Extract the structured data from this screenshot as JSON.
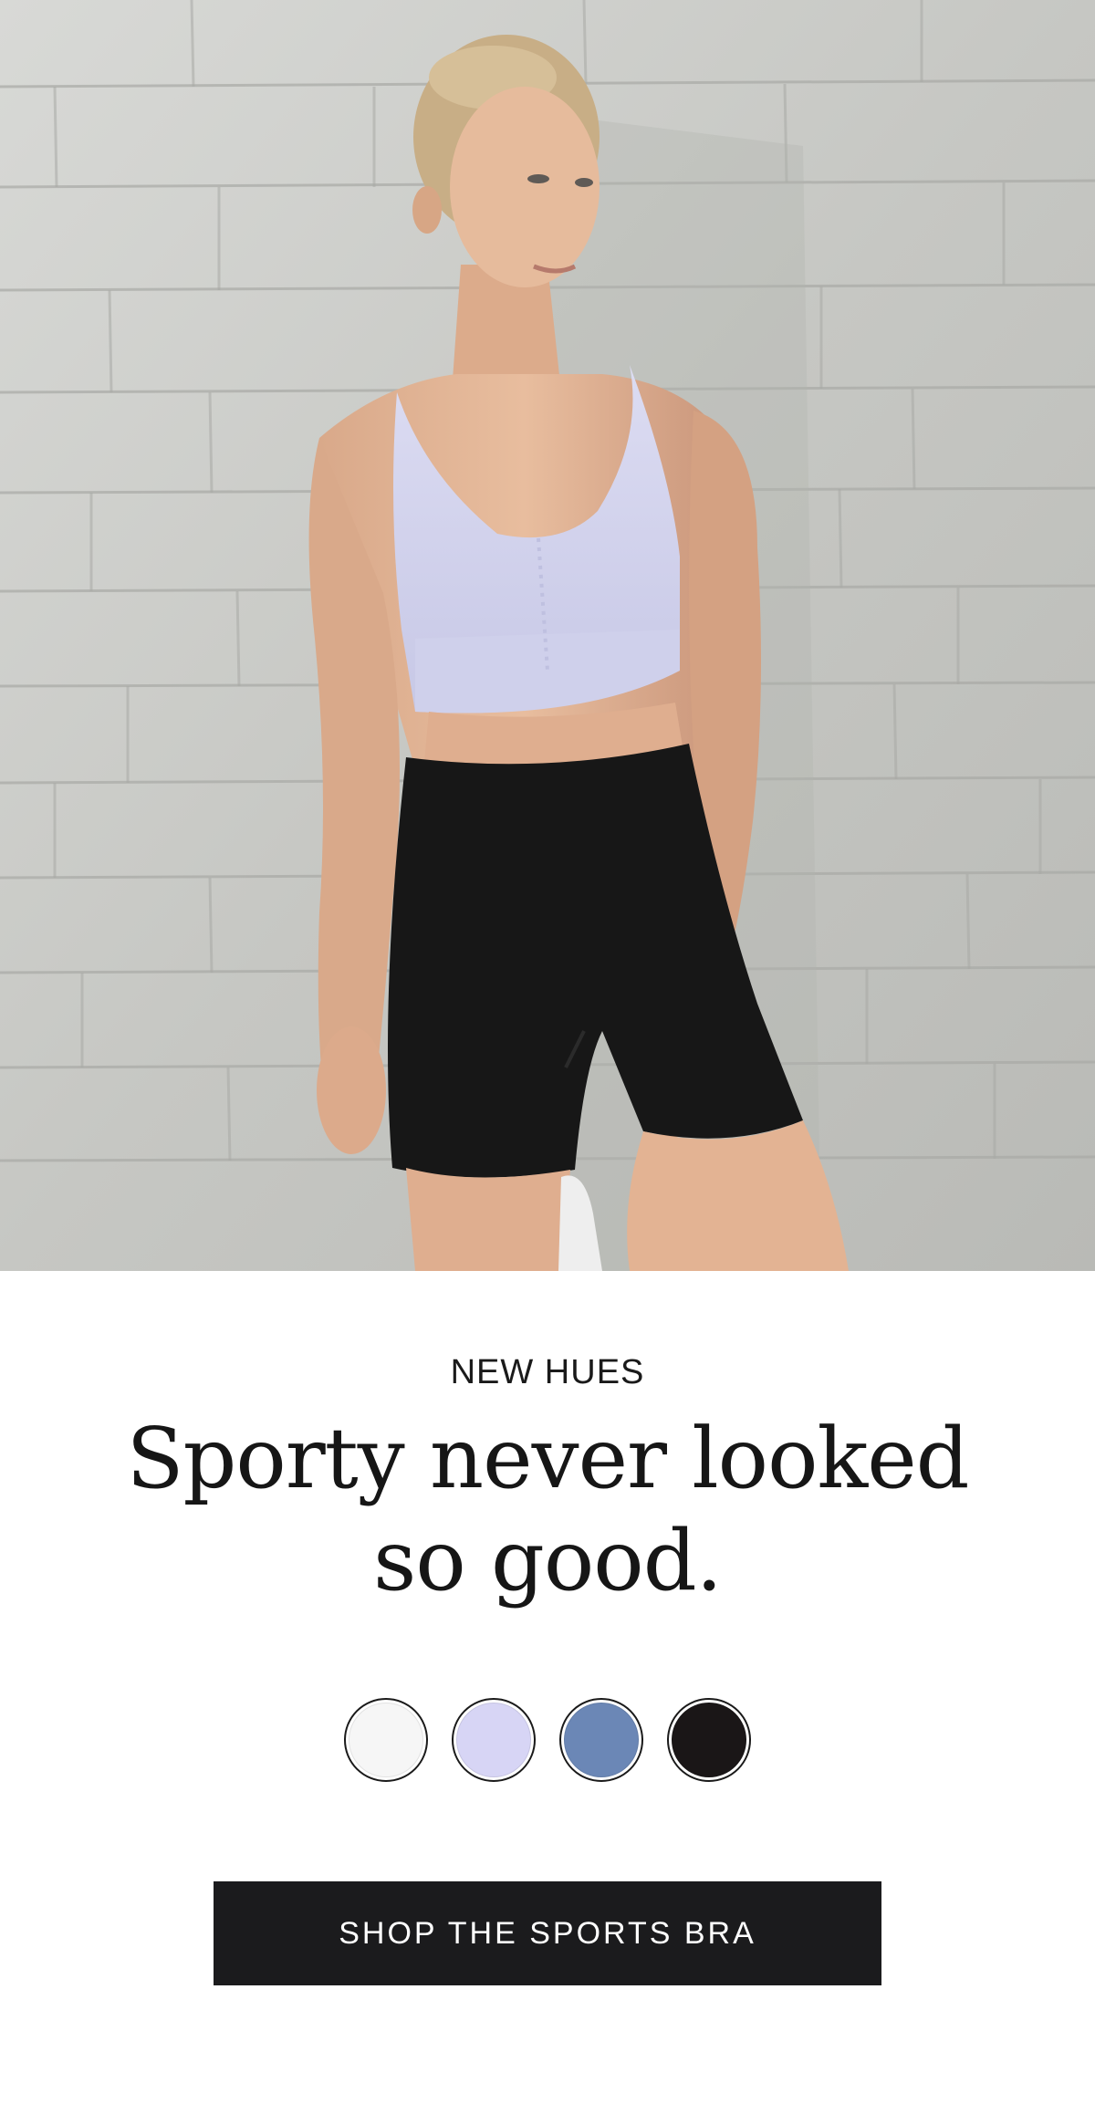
{
  "hero": {
    "image_name": "model-sports-bra-photo"
  },
  "promo": {
    "eyebrow": "NEW HUES",
    "headline": "Sporty never looked so good.",
    "cta_label": "SHOP THE SPORTS BRA"
  },
  "swatches": [
    {
      "name": "white",
      "color": "#f6f6f6"
    },
    {
      "name": "lavender",
      "color": "#d7d5f5"
    },
    {
      "name": "blue",
      "color": "#6b87b6"
    },
    {
      "name": "black",
      "color": "#1a1617"
    }
  ],
  "colors": {
    "wall": "#c8c9c6",
    "cta_background": "#1b1b1d",
    "cta_text": "#ffffff"
  }
}
